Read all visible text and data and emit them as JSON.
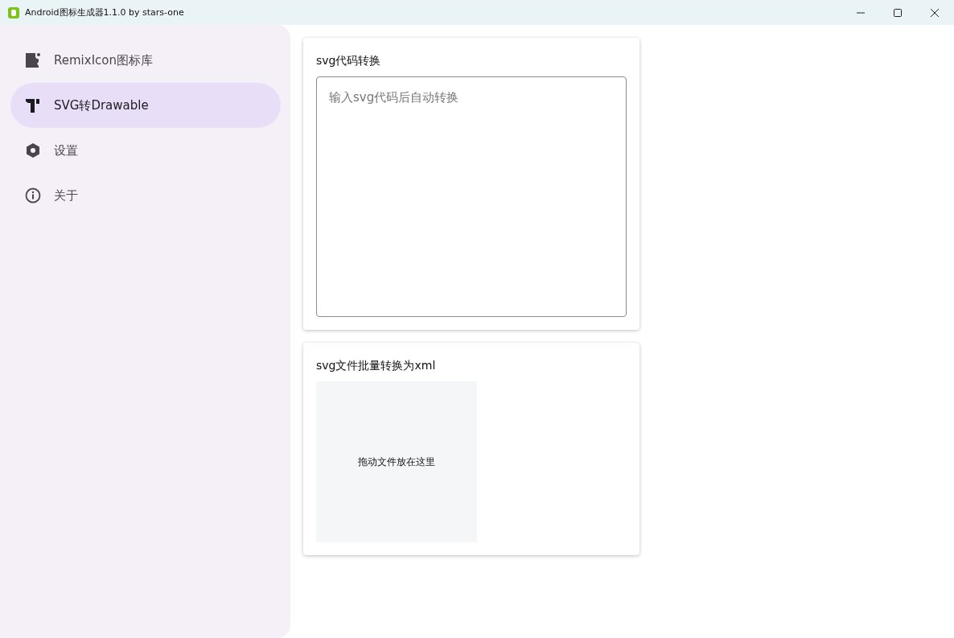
{
  "window": {
    "title": "Android图标生成器1.1.0 by stars-one"
  },
  "sidebar": {
    "items": [
      {
        "label": "RemixIcon图标库",
        "kind": "library",
        "selected": false
      },
      {
        "label": "SVG转Drawable",
        "kind": "tool",
        "selected": true
      },
      {
        "label": "设置",
        "kind": "settings",
        "selected": false
      },
      {
        "label": "关于",
        "kind": "info",
        "selected": false
      }
    ]
  },
  "code_card": {
    "title": "svg代码转换",
    "placeholder": "输入svg代码后自动转换"
  },
  "batch_card": {
    "title": "svg文件批量转换为xml",
    "drop_zone": "拖动文件放在这里"
  }
}
